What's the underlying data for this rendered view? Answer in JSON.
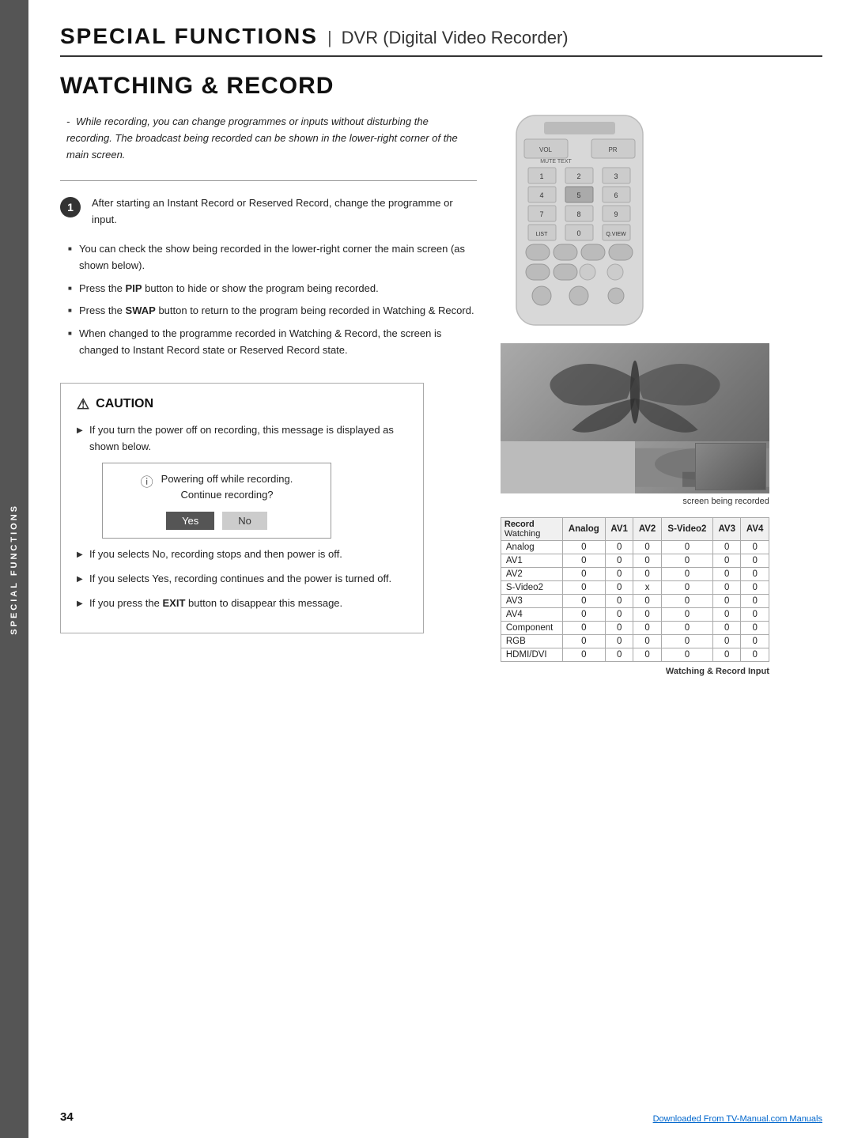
{
  "header": {
    "special": "SPECIAL FUNCTIONS",
    "divider": "|",
    "subtitle": "DVR (Digital Video Recorder)"
  },
  "section": {
    "title": "WATCHING & RECORD"
  },
  "intro": {
    "dash": "-",
    "text": "While recording, you can change programmes or inputs without disturbing the recording. The broadcast being recorded can be shown in the lower-right corner of the main screen."
  },
  "step1": {
    "number": "1",
    "text": "After starting an Instant Record or Reserved Record, change the programme or input."
  },
  "bullets": [
    "You can check the show being recorded in the lower-right corner the main screen (as shown below).",
    "Press the PIP button to hide or show the program being recorded.",
    "Press the SWAP button to return to the program being recorded in Watching & Record.",
    "When changed to the programme recorded in Watching & Record, the screen is changed to Instant Record state or Reserved Record state."
  ],
  "screen_caption": "screen being recorded",
  "table": {
    "caption": "Watching & Record Input",
    "header_row": [
      "Record\nWatching",
      "Analog",
      "AV1",
      "AV2",
      "S-Video2",
      "AV3",
      "AV4"
    ],
    "rows": [
      {
        "label": "Analog",
        "vals": [
          "0",
          "0",
          "0",
          "0",
          "0",
          "0"
        ]
      },
      {
        "label": "AV1",
        "vals": [
          "0",
          "0",
          "0",
          "0",
          "0",
          "0"
        ]
      },
      {
        "label": "AV2",
        "vals": [
          "0",
          "0",
          "0",
          "0",
          "0",
          "0"
        ]
      },
      {
        "label": "S-Video2",
        "vals": [
          "0",
          "0",
          "x",
          "0",
          "0",
          "0"
        ]
      },
      {
        "label": "AV3",
        "vals": [
          "0",
          "0",
          "0",
          "0",
          "0",
          "0"
        ]
      },
      {
        "label": "AV4",
        "vals": [
          "0",
          "0",
          "0",
          "0",
          "0",
          "0"
        ]
      },
      {
        "label": "Component",
        "vals": [
          "0",
          "0",
          "0",
          "0",
          "0",
          "0"
        ]
      },
      {
        "label": "RGB",
        "vals": [
          "0",
          "0",
          "0",
          "0",
          "0",
          "0"
        ]
      },
      {
        "label": "HDMI/DVI",
        "vals": [
          "0",
          "0",
          "0",
          "0",
          "0",
          "0"
        ]
      }
    ]
  },
  "caution": {
    "icon": "⚠",
    "title": "CAUTION",
    "items": [
      {
        "text": "If you turn the power off on recording, this message is displayed as shown below.",
        "has_dialog": true
      },
      {
        "text": "If you selects No, recording stops and then power is off.",
        "has_dialog": false
      },
      {
        "text": "If you selects Yes, recording continues and the power is turned off.",
        "has_dialog": false
      },
      {
        "text": "If you press the EXIT button to disappear this message.",
        "has_dialog": false
      }
    ],
    "dialog": {
      "icon": "ⓘ",
      "line1": "Powering off while recording.",
      "line2": "Continue recording?",
      "yes_label": "Yes",
      "no_label": "No"
    }
  },
  "sidebar_text": "SPECIAL FUNCTIONS",
  "footer": {
    "page_number": "34",
    "link_text": "Downloaded From TV-Manual.com Manuals",
    "link_url": "#"
  }
}
